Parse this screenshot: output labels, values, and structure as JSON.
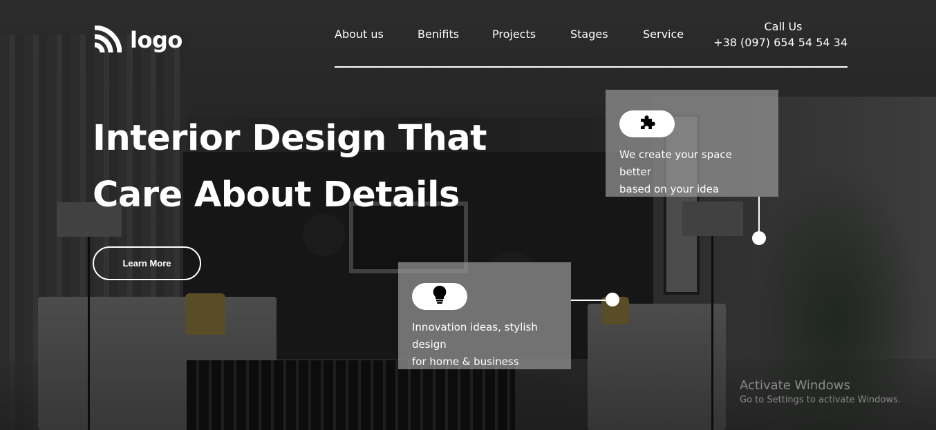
{
  "header": {
    "logo_text": "logo",
    "nav": [
      "About us",
      "Benifits",
      "Projects",
      "Stages",
      "Service"
    ],
    "call_label": "Call Us",
    "call_phone": "+38 (097) 654 54 54 34"
  },
  "hero": {
    "title_line1": "Interior Design That",
    "title_line2": "Care About Details",
    "button_label": "Learn More"
  },
  "cards": [
    {
      "icon": "puzzle-icon",
      "lines": [
        "We create your space",
        "better",
        "based on your idea"
      ]
    },
    {
      "icon": "lightbulb-icon",
      "lines": [
        "Innovation ideas, stylish",
        "design",
        "for home & business"
      ]
    }
  ],
  "watermark": {
    "title": "Activate Windows",
    "subtitle": "Go to Settings to activate Windows."
  },
  "colors": {
    "text": "#ffffff",
    "card_bg": "#969696",
    "overlay": "#000000"
  }
}
